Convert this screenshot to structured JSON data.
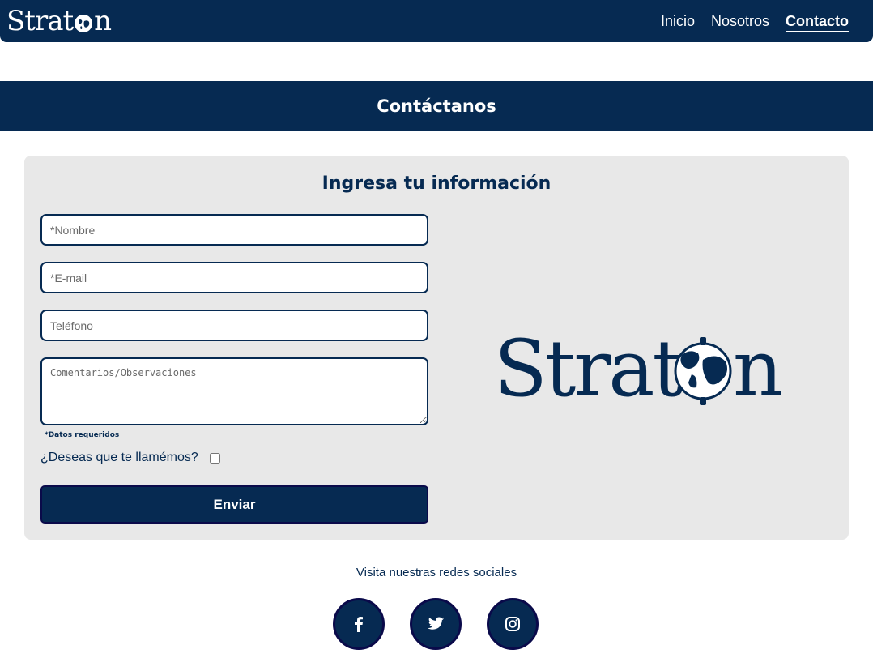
{
  "brand": {
    "logo_text_left": "Strat",
    "logo_text_right": "n"
  },
  "nav": {
    "items": [
      {
        "label": "Inicio",
        "active": false
      },
      {
        "label": "Nosotros",
        "active": false
      },
      {
        "label": "Contacto",
        "active": true
      }
    ]
  },
  "hero": {
    "title": "Contáctanos"
  },
  "form": {
    "title": "Ingresa tu información",
    "name_placeholder": "*Nombre",
    "email_placeholder": "*E-mail",
    "phone_placeholder": "Teléfono",
    "comments_placeholder": "Comentarios/Observaciones",
    "required_note": "*Datos requeridos",
    "callback_label": "¿Deseas que te llamémos?",
    "callback_checked": false,
    "submit_label": "Enviar"
  },
  "social": {
    "caption": "Visita nuestras redes sociales",
    "icons": [
      "facebook-icon",
      "twitter-icon",
      "instagram-icon"
    ]
  },
  "colors": {
    "primary": "#062a52",
    "card_bg": "#e8e8e8",
    "text_light": "#ffffff"
  }
}
